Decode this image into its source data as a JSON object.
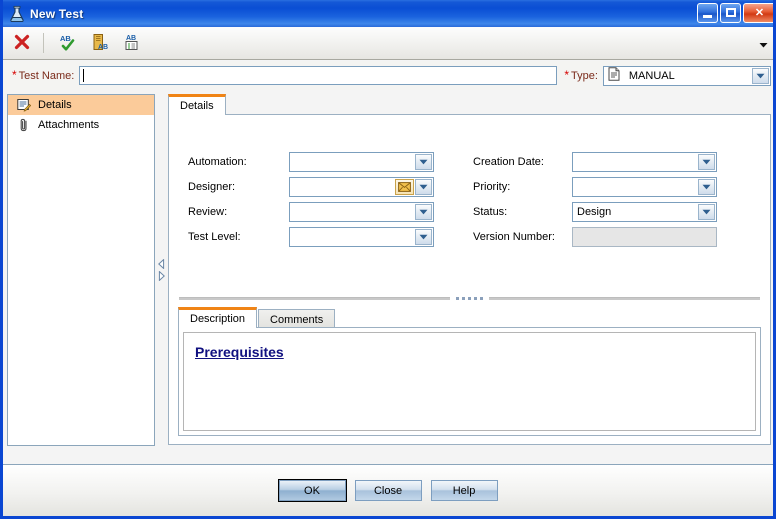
{
  "window": {
    "title": "New Test",
    "icon": "flask-icon",
    "controls": {
      "minimize": "Minimize",
      "maximize": "Maximize",
      "close": "Close"
    }
  },
  "toolbar": {
    "buttons": [
      {
        "name": "clear-field-button",
        "icon": "red-x-icon",
        "tooltip": "Clear"
      },
      {
        "name": "check-spelling-button",
        "icon": "spell-check-icon",
        "tooltip": "Check Spelling"
      },
      {
        "name": "thesaurus-button",
        "icon": "thesaurus-icon",
        "tooltip": "Thesaurus"
      },
      {
        "name": "spelling-options-button",
        "icon": "spelling-options-icon",
        "tooltip": "Spelling Options"
      }
    ],
    "overflow_icon": "chevron-down-icon"
  },
  "header_fields": {
    "test_name": {
      "required_marker": "*",
      "label": "Test Name:",
      "value": "",
      "placeholder": ""
    },
    "type": {
      "required_marker": "*",
      "label": "Type:",
      "value": "MANUAL",
      "icon": "manual-test-icon"
    }
  },
  "sidebar": {
    "items": [
      {
        "label": "Details",
        "icon": "details-form-icon",
        "selected": true
      },
      {
        "label": "Attachments",
        "icon": "paperclip-icon",
        "selected": false
      }
    ],
    "splitter": {
      "collapse_icon": "triangle-left-icon",
      "expand_icon": "triangle-right-icon"
    }
  },
  "main": {
    "tabs": [
      {
        "label": "Details",
        "active": true
      }
    ],
    "fields_left": [
      {
        "label": "Automation:",
        "value": "",
        "type": "combo"
      },
      {
        "label": "Designer:",
        "value": "",
        "type": "combo-mail",
        "mail_icon": "envelope-icon"
      },
      {
        "label": "Review:",
        "value": "",
        "type": "combo"
      },
      {
        "label": "Test Level:",
        "value": "",
        "type": "combo"
      }
    ],
    "fields_right": [
      {
        "label": "Creation Date:",
        "value": "",
        "type": "combo"
      },
      {
        "label": "Priority:",
        "value": "",
        "type": "combo"
      },
      {
        "label": "Status:",
        "value": "Design",
        "type": "combo"
      },
      {
        "label": "Version Number:",
        "value": "",
        "type": "readonly"
      }
    ],
    "description": {
      "tabs": [
        {
          "label": "Description",
          "active": true
        },
        {
          "label": "Comments",
          "active": false
        }
      ],
      "content_heading": "Prerequisites"
    }
  },
  "footer": {
    "buttons": [
      {
        "label": "OK",
        "default": true
      },
      {
        "label": "Close",
        "default": false
      },
      {
        "label": "Help",
        "default": false
      }
    ]
  },
  "colors": {
    "title_blue": "#0a4ed4",
    "accent_orange": "#f08416",
    "selection_orange": "#fbcb9a",
    "required_red": "#d60000",
    "label_maroon": "#7a2a1a",
    "heading_navy": "#101080"
  }
}
